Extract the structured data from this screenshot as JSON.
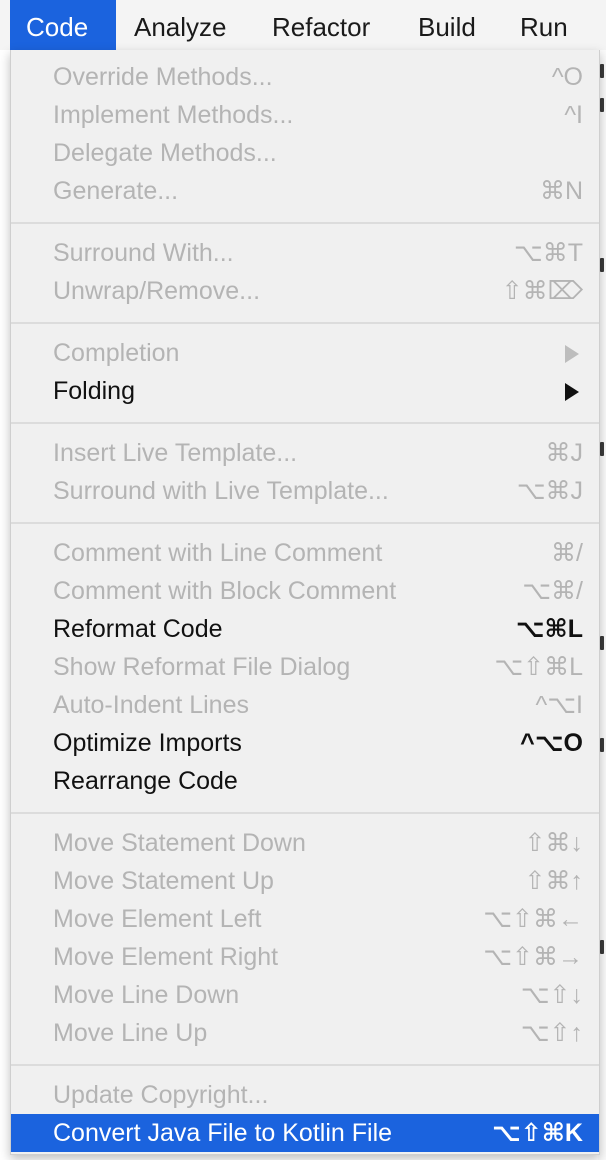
{
  "menubar": {
    "items": [
      "Code",
      "Analyze",
      "Refactor",
      "Build",
      "Run"
    ]
  },
  "menu": {
    "items": [
      {
        "label": "Override Methods...",
        "shortcut": "^O",
        "enabled": false
      },
      {
        "label": "Implement Methods...",
        "shortcut": "^I",
        "enabled": false
      },
      {
        "label": "Delegate Methods...",
        "shortcut": "",
        "enabled": false
      },
      {
        "label": "Generate...",
        "shortcut": "⌘N",
        "enabled": false
      },
      {
        "label": "Surround With...",
        "shortcut": "⌥⌘T",
        "enabled": false
      },
      {
        "label": "Unwrap/Remove...",
        "shortcut": "⇧⌘⌦",
        "enabled": false
      },
      {
        "label": "Completion",
        "shortcut": "",
        "submenu": true,
        "enabled": false
      },
      {
        "label": "Folding",
        "shortcut": "",
        "submenu": true,
        "enabled": true
      },
      {
        "label": "Insert Live Template...",
        "shortcut": "⌘J",
        "enabled": false
      },
      {
        "label": "Surround with Live Template...",
        "shortcut": "⌥⌘J",
        "enabled": false
      },
      {
        "label": "Comment with Line Comment",
        "shortcut": "⌘/",
        "enabled": false
      },
      {
        "label": "Comment with Block Comment",
        "shortcut": "⌥⌘/",
        "enabled": false
      },
      {
        "label": "Reformat Code",
        "shortcut": "⌥⌘L",
        "enabled": true
      },
      {
        "label": "Show Reformat File Dialog",
        "shortcut": "⌥⇧⌘L",
        "enabled": false
      },
      {
        "label": "Auto-Indent Lines",
        "shortcut": "^⌥I",
        "enabled": false
      },
      {
        "label": "Optimize Imports",
        "shortcut": "^⌥O",
        "enabled": true
      },
      {
        "label": "Rearrange Code",
        "shortcut": "",
        "enabled": true
      },
      {
        "label": "Move Statement Down",
        "shortcut": "⇧⌘↓",
        "enabled": false
      },
      {
        "label": "Move Statement Up",
        "shortcut": "⇧⌘↑",
        "enabled": false
      },
      {
        "label": "Move Element Left",
        "shortcut": "⌥⇧⌘←",
        "enabled": false
      },
      {
        "label": "Move Element Right",
        "shortcut": "⌥⇧⌘→",
        "enabled": false
      },
      {
        "label": "Move Line Down",
        "shortcut": "⌥⇧↓",
        "enabled": false
      },
      {
        "label": "Move Line Up",
        "shortcut": "⌥⇧↑",
        "enabled": false
      },
      {
        "label": "Update Copyright...",
        "shortcut": "",
        "enabled": false
      },
      {
        "label": "Convert Java File to Kotlin File",
        "shortcut": "⌥⇧⌘K",
        "enabled": true,
        "highlighted": true
      }
    ]
  },
  "colors": {
    "highlight": "#1b63de",
    "disabled_text": "#b4b4b4",
    "enabled_text": "#111111",
    "menu_background": "#f0f0f0"
  }
}
